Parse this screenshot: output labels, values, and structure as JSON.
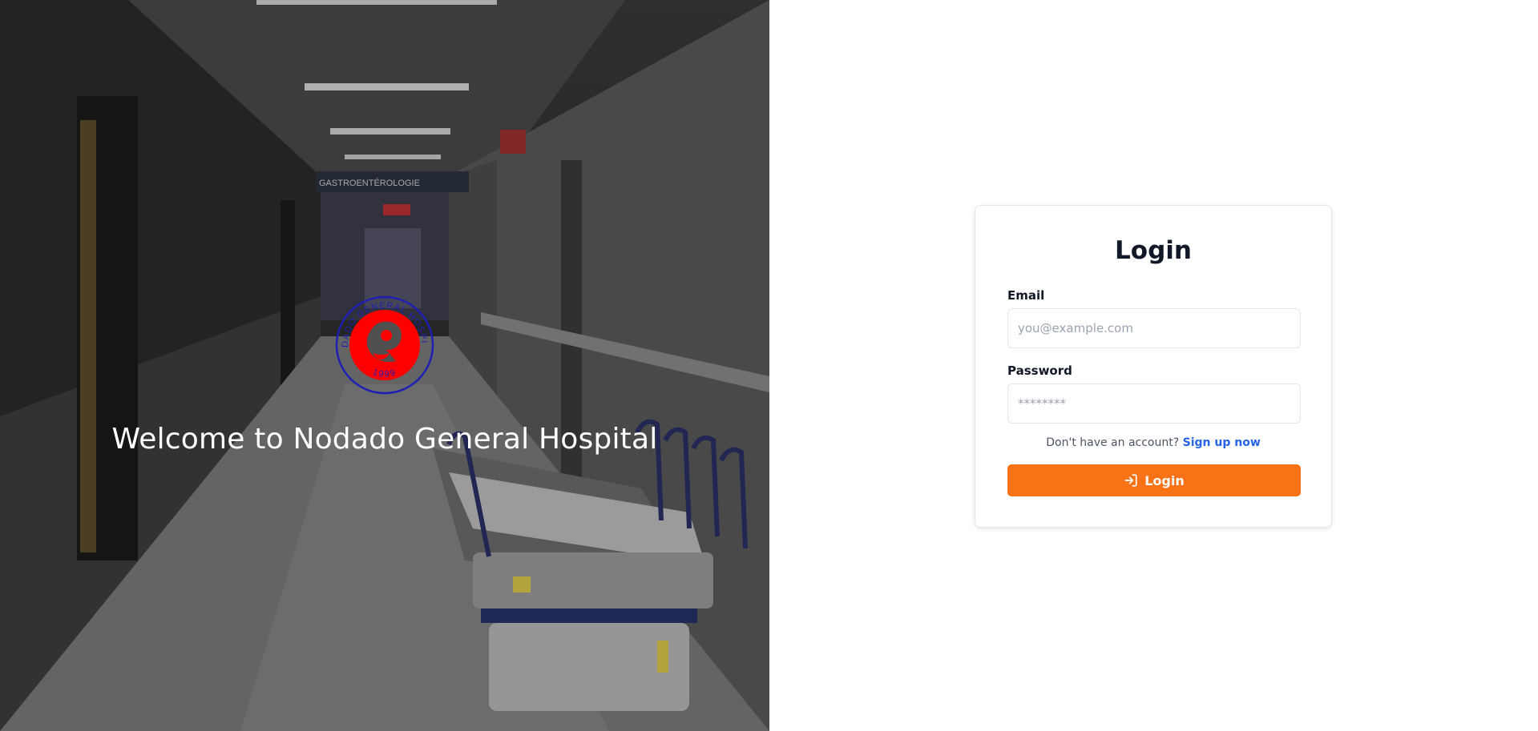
{
  "hero": {
    "welcome_text": "Welcome to Nodado General Hospital",
    "logo": {
      "ring_text_top": "NODADO GENERAL HOSPITAL",
      "ring_text_bottom": "1999",
      "icon": "hospital-seal-logo",
      "ring_color": "#1f1fb3",
      "center_color": "#ff0000"
    },
    "background": {
      "description_icon": "hospital-corridor-photo",
      "sign_text": "GASTROENTÉROLOGIE"
    }
  },
  "login_card": {
    "title": "Login",
    "email": {
      "label": "Email",
      "placeholder": "you@example.com",
      "value": ""
    },
    "password": {
      "label": "Password",
      "placeholder": "********",
      "value": ""
    },
    "signup": {
      "prompt": "Don't have an account?",
      "link_label": "Sign up now"
    },
    "submit": {
      "label": "Login",
      "icon": "login-arrow-icon"
    }
  },
  "colors": {
    "accent": "#f97316",
    "link": "#2563eb",
    "heading": "#111827"
  }
}
